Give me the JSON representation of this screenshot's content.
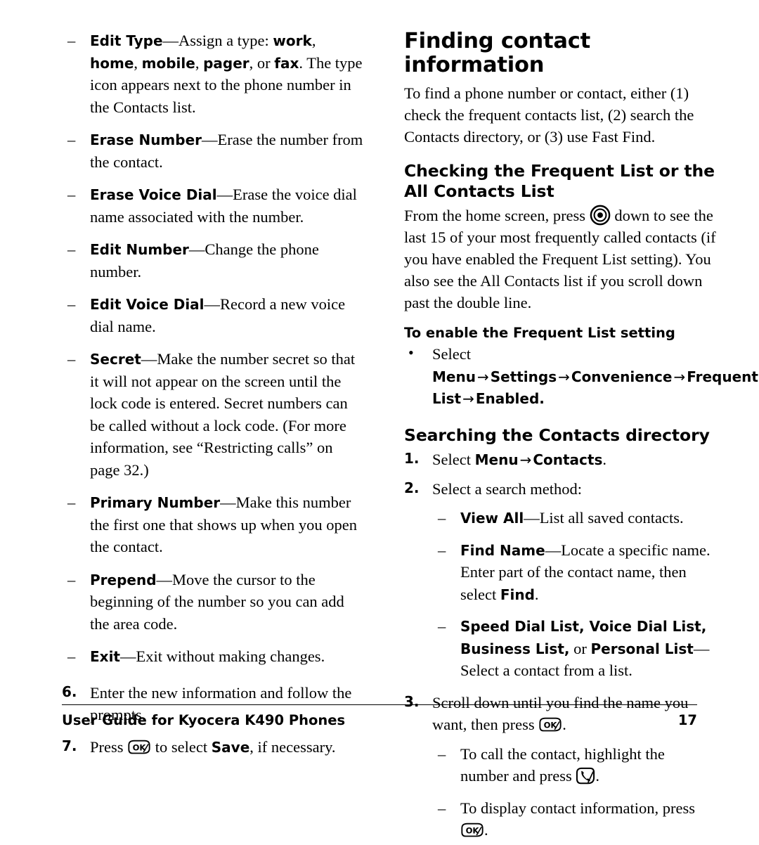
{
  "document": {
    "footer": {
      "text": "User Guide for Kyocera K490 Phones",
      "page_number": "17"
    }
  },
  "left_column": {
    "list_items": [
      {
        "id": "edit-type",
        "term": "Edit Type",
        "text_parts": [
          "—Assign a type: ",
          "work",
          ", ",
          "home",
          ", ",
          "mobile",
          ", ",
          "pager",
          ", or ",
          "fax",
          ". The type icon appears next to the phone number in the Contacts list."
        ]
      },
      {
        "id": "erase-number",
        "term": "Erase Number",
        "text": "—Erase the number from the contact."
      },
      {
        "id": "erase-voice-dial",
        "term": "Erase Voice Dial",
        "text": "—Erase the voice dial name associated with the number."
      },
      {
        "id": "edit-number",
        "term": "Edit Number",
        "text": "—Change the phone number."
      },
      {
        "id": "edit-voice-dial",
        "term": "Edit Voice Dial",
        "text": "—Record a new voice dial name."
      },
      {
        "id": "secret",
        "term": "Secret",
        "text": "—Make the number secret so that it will not appear on the screen until the lock code is entered. Secret numbers can be called without a lock code. (For more information, see “Restricting calls” on page 32.)"
      },
      {
        "id": "primary-number",
        "term": "Primary Number",
        "text": "—Make this number the first one that shows up when you open the contact."
      },
      {
        "id": "prepend",
        "term": "Prepend",
        "text": "—Move the cursor to the beginning of the number so you can add the area code."
      },
      {
        "id": "exit",
        "term": "Exit",
        "text": "—Exit without making changes."
      }
    ],
    "step6": {
      "number": "6.",
      "text": "Enter the new information and follow the prompts."
    },
    "step7": {
      "number": "7.",
      "text_before": "Press ",
      "text_middle": " to select ",
      "bold": "Save",
      "text_after": ", if necessary."
    },
    "dash": "–"
  },
  "right_column": {
    "heading": "Finding contact information",
    "intro": "To find a phone number or contact, either (1) check the frequent contacts list, (2) search the Contacts directory, or (3) use Fast Find.",
    "section_frequent": {
      "heading": "Checking the Frequent List or the All Contacts List",
      "body_before": "From the home screen, press ",
      "body_after": " down to see the last 15 of your most frequently called contacts (if you have enabled the Frequent List setting). You also see the All Contacts list if you scroll down past the double line.",
      "subheading": "To enable the Frequent List setting",
      "bullet": {
        "select": "Select ",
        "items": [
          "Menu",
          "Settings",
          "Convenience",
          "Frequent List",
          "Enabled"
        ],
        "arrow": "→",
        "period": "."
      }
    },
    "section_searching": {
      "heading": "Searching the Contacts directory",
      "step1": {
        "number": "1.",
        "text_before": "Select ",
        "bold1": "Menu",
        "arrow": "→",
        "bold2": "Contacts",
        "period": "."
      },
      "step2": {
        "number": "2.",
        "text": "Select a search method:"
      },
      "step2_items": [
        {
          "id": "view-all",
          "term": "View All",
          "text": "—List all saved contacts."
        },
        {
          "id": "find-name",
          "term": "Find Name",
          "text_parts": [
            "—Locate a specific name. Enter part of the contact name, then select ",
            "Find",
            "."
          ]
        },
        {
          "id": "list-types",
          "term_parts": [
            "Speed Dial List, Voice Dial List, Business List,",
            " or ",
            "Personal List"
          ],
          "text": "—Select a contact from a list."
        }
      ],
      "step3": {
        "number": "3.",
        "text_before": "Scroll down until you find the name you want, then press ",
        "text_after": "."
      },
      "step3_items": [
        {
          "id": "call-contact",
          "text_before": "To call the contact, highlight the number and press ",
          "text_after": "."
        },
        {
          "id": "display-info",
          "text_before": "To display contact information, press ",
          "text_after": "."
        }
      ]
    },
    "dash": "–",
    "bullet_dot": "•"
  },
  "icons": {
    "ok_key": "ok-key-icon",
    "nav_key": "navigation-key-icon",
    "send_key": "send-key-icon"
  }
}
